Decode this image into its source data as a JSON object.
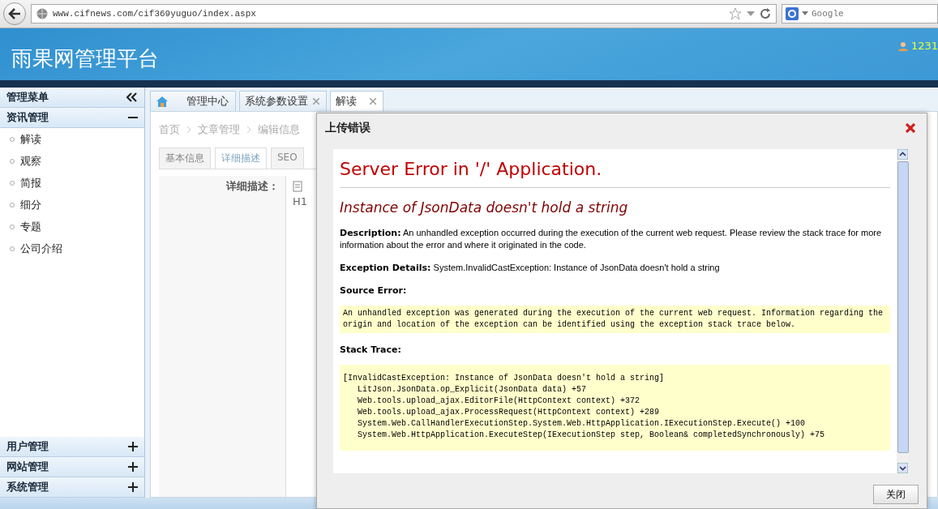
{
  "browser": {
    "url": "www.cifnews.com/cif369yuguo/index.aspx",
    "search_placeholder": "Google"
  },
  "header": {
    "title": "雨果网管理平台",
    "user": "1231"
  },
  "sidebar": {
    "title": "管理菜单",
    "sections": [
      {
        "label": "资讯管理",
        "expanded": true,
        "items": [
          "解读",
          "观察",
          "简报",
          "细分",
          "专题",
          "公司介绍"
        ]
      },
      {
        "label": "用户管理",
        "expanded": false
      },
      {
        "label": "网站管理",
        "expanded": false
      },
      {
        "label": "系统管理",
        "expanded": false
      }
    ]
  },
  "tabs": [
    {
      "label": "管理中心",
      "kind": "home",
      "selected": false
    },
    {
      "label": "系统参数设置",
      "kind": "closable",
      "selected": false
    },
    {
      "label": "解读",
      "kind": "closable",
      "selected": true
    }
  ],
  "content": {
    "breadcrumb": [
      "首页",
      "文章管理",
      "编辑信息"
    ],
    "form_tabs": [
      {
        "label": "基本信息",
        "selected": false
      },
      {
        "label": "详细描述",
        "selected": true
      },
      {
        "label": "SEO",
        "selected": false
      }
    ],
    "field_label": "详细描述：",
    "editor_heading": "H1"
  },
  "dialog": {
    "title": "上传错误",
    "close_button": "关闭",
    "error": {
      "heading": "Server Error in '/' Application.",
      "message": "Instance of JsonData doesn't hold a string",
      "description": "**Description:** An unhandled exception occurred during the execution of the current web request. Please review the stack trace for more information about the error and where it originated in the code.",
      "details": "**Exception Details:** System.InvalidCastException: Instance of JsonData doesn't hold a string",
      "source_label": "Source Error:",
      "source_text": "An unhandled exception was generated during the execution of the current web request. Information regarding the origin and location of the exception can be identified using the exception stack trace below.",
      "stack_label": "Stack Trace:",
      "stack": [
        "[InvalidCastException: Instance of JsonData doesn't hold a string]",
        "   LitJson.JsonData.op_Explicit(JsonData data) +57",
        "   Web.tools.upload_ajax.EditorFile(HttpContext context) +372",
        "   Web.tools.upload_ajax.ProcessRequest(HttpContext context) +289",
        "   System.Web.CallHandlerExecutionStep.System.Web.HttpApplication.IExecutionStep.Execute() +100",
        "   System.Web.HttpApplication.ExecuteStep(IExecutionStep step, Boolean& completedSynchronously) +75"
      ]
    }
  }
}
